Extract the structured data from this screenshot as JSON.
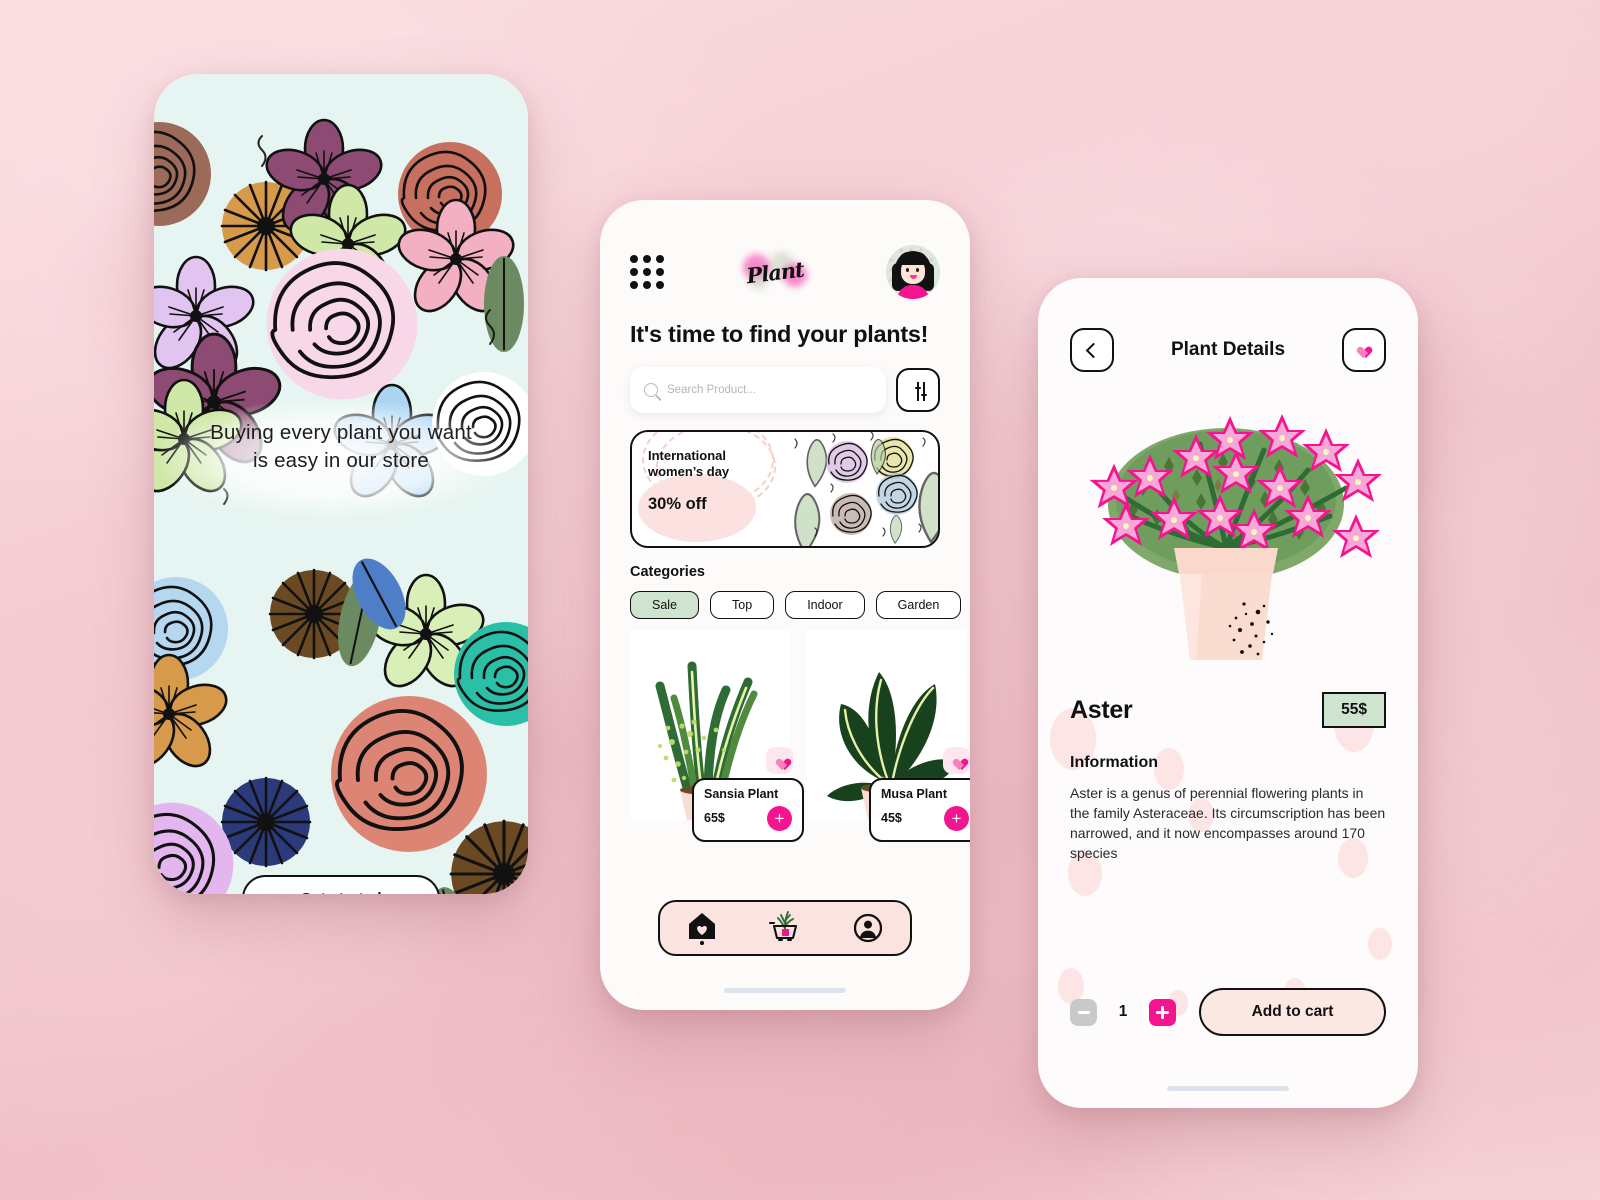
{
  "theme": {
    "bg_pink": "#f3c8cd",
    "accent_magenta": "#f5148f",
    "accent_mint": "#cfe4cf",
    "accent_blush": "#fce8e3",
    "ink": "#111111"
  },
  "screen_onboarding": {
    "name": "onboarding",
    "headline": "Buying every plant you want\nis easy in our store",
    "headline_line1": "Buying every plant you want",
    "headline_line2": "is easy in our store",
    "cta_label": "Get started"
  },
  "screen_home": {
    "name": "home",
    "menu_icon": "grid-menu-icon",
    "logo_text": "Plant",
    "avatar_icon": "user-avatar",
    "title": "It's time to find your plants!",
    "search": {
      "icon": "search-icon",
      "placeholder": "Search Product...",
      "value": "",
      "filter_icon": "filter-sliders-icon"
    },
    "banner": {
      "line1": "International",
      "line2": "women’s day",
      "discount": "30% off"
    },
    "categories_heading": "Categories",
    "categories": [
      {
        "label": "Sale",
        "selected": true
      },
      {
        "label": "Top",
        "selected": false
      },
      {
        "label": "Indoor",
        "selected": false
      },
      {
        "label": "Garden",
        "selected": false
      }
    ],
    "products": [
      {
        "name": "Sansia Plant",
        "price": "65$",
        "fav_icon": "heart-icon",
        "add_icon": "plus-icon"
      },
      {
        "name": "Musa Plant",
        "price": "45$",
        "fav_icon": "heart-icon",
        "add_icon": "plus-icon"
      }
    ],
    "tabbar": [
      {
        "icon": "home-heart-icon",
        "active": true
      },
      {
        "icon": "cart-plant-icon",
        "active": false
      },
      {
        "icon": "profile-icon",
        "active": false
      }
    ]
  },
  "screen_details": {
    "name": "plant-details",
    "back_icon": "chevron-left-icon",
    "title": "Plant Details",
    "favorite_icon": "heart-icon",
    "plant_image": "aster-potted-plant",
    "plant_name": "Aster",
    "price": "55$",
    "info_heading": "Information",
    "info_body": "Aster is a genus of perennial flowering plants in the family Asteraceae. Its circumscription has been narrowed, and it now encompasses around 170 species",
    "quantity": "1",
    "decrement_icon": "minus-icon",
    "increment_icon": "plus-icon",
    "cta_label": "Add to cart"
  }
}
